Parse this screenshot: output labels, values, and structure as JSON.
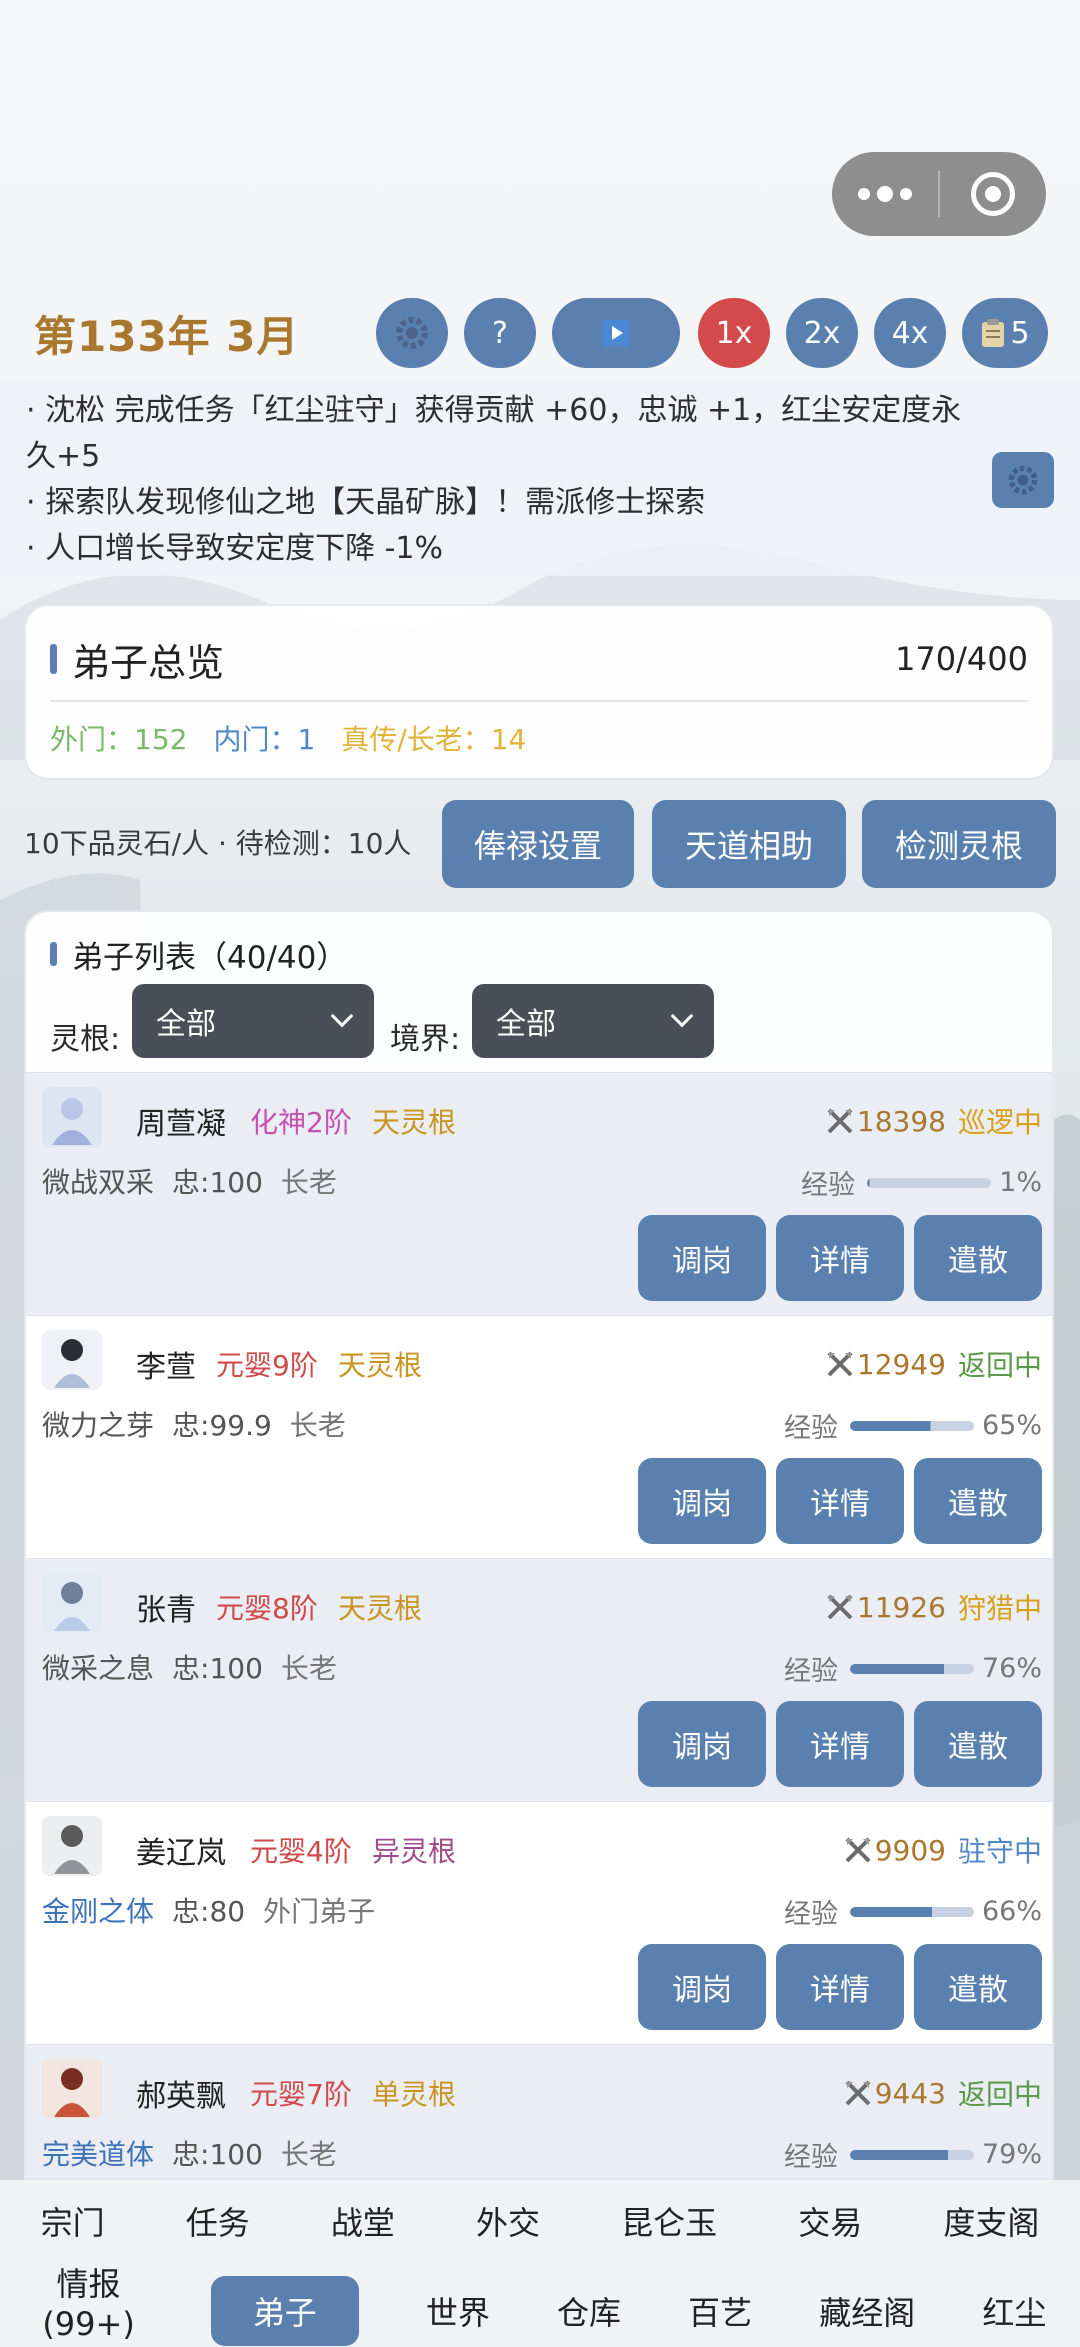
{
  "capsule": {
    "more_icon": "more-dots-icon",
    "close_icon": "target-circle-icon"
  },
  "header": {
    "date": "第133年 3月",
    "help": "?",
    "speed_1x": "1x",
    "speed_2x": "2x",
    "speed_4x": "4x",
    "log_count": "5",
    "colors": {
      "accent": "#5a80b0",
      "active_speed": "#d44a4a",
      "date": "#a9782e"
    }
  },
  "news": [
    "· 沈松 完成任务「红尘驻守」获得贡献 +60，忠诚 +1，红尘安定度永久+5",
    "· 探索队发现修仙之地【天晶矿脉】！需派修士探索",
    "· 人口增长导致安定度下降 -1%"
  ],
  "overview": {
    "title": "弟子总览",
    "count": "170/400",
    "outer": "外门：152",
    "inner": "内门：1",
    "elder": "真传/长老：14"
  },
  "salary": {
    "text": "10下品灵石/人 · 待检测：10人",
    "btn_salary": "俸禄设置",
    "btn_help": "天道相助",
    "btn_detect": "检测灵根"
  },
  "list": {
    "title": "弟子列表（40/40）",
    "root_label": "灵根:",
    "root_value": "全部",
    "realm_label": "境界:",
    "realm_value": "全部",
    "btn_transfer": "调岗",
    "btn_detail": "详情",
    "btn_dismiss": "遣散",
    "exp_label": "经验",
    "disciples": [
      {
        "name": "周萱凝",
        "realm": "化神2阶",
        "root": "天灵根",
        "trait": "微战双采",
        "loyalty": "忠:100",
        "rank": "长老",
        "power": "18398",
        "status": "巡逻中",
        "exp": "1%",
        "exp_value": 0.01
      },
      {
        "name": "李萱",
        "realm": "元婴9阶",
        "root": "天灵根",
        "trait": "微力之芽",
        "loyalty": "忠:99.9",
        "rank": "长老",
        "power": "12949",
        "status": "返回中",
        "exp": "65%",
        "exp_value": 0.65
      },
      {
        "name": "张青",
        "realm": "元婴8阶",
        "root": "天灵根",
        "trait": "微采之息",
        "loyalty": "忠:100",
        "rank": "长老",
        "power": "11926",
        "status": "狩猎中",
        "exp": "76%",
        "exp_value": 0.76
      },
      {
        "name": "姜辽岚",
        "realm": "元婴4阶",
        "root": "异灵根",
        "trait": "金刚之体",
        "loyalty": "忠:80",
        "rank": "外门弟子",
        "power": "9909",
        "status": "驻守中",
        "exp": "66%",
        "exp_value": 0.66
      },
      {
        "name": "郝英飘",
        "realm": "元婴7阶",
        "root": "单灵根",
        "trait": "完美道体",
        "loyalty": "忠:100",
        "rank": "长老",
        "power": "9443",
        "status": "返回中",
        "exp": "79%",
        "exp_value": 0.79
      }
    ]
  },
  "nav": {
    "row1": [
      "宗门",
      "任务",
      "战堂",
      "外交",
      "昆仑玉",
      "交易",
      "度支阁"
    ],
    "row2": [
      "情报(99+)",
      "弟子",
      "世界",
      "仓库",
      "百艺",
      "藏经阁",
      "红尘"
    ]
  }
}
